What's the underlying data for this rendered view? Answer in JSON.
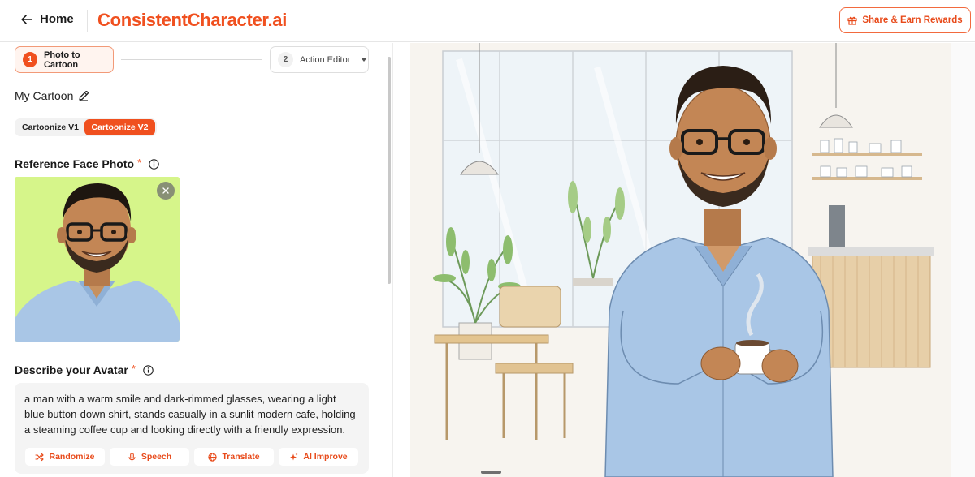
{
  "header": {
    "home_label": "Home",
    "logo": "ConsistentCharacter.ai",
    "share_label": "Share & Earn Rewards"
  },
  "steps": [
    {
      "num": "1",
      "label": "Photo to Cartoon",
      "active": true
    },
    {
      "num": "2",
      "label": "Action Editor",
      "active": false
    }
  ],
  "cartoon": {
    "name": "My Cartoon"
  },
  "version_tabs": {
    "v1": "Cartoonize V1",
    "v2": "Cartoonize V2",
    "selected": "Cartoonize V2"
  },
  "reference": {
    "label": "Reference Face Photo",
    "required": "*"
  },
  "describe": {
    "label": "Describe your Avatar",
    "required": "*",
    "text": "a man with a warm smile and dark-rimmed glasses, wearing a light blue button-down shirt, stands casually in a sunlit modern cafe, holding a steaming coffee cup and looking directly with a friendly expression."
  },
  "tools": {
    "randomize": "Randomize",
    "speech": "Speech",
    "translate": "Translate",
    "improve": "AI Improve"
  },
  "colors": {
    "accent": "#f0501f",
    "photo_bg": "#d6f58a",
    "shirt": "#a9c6e6"
  },
  "icons": [
    "arrow-left-icon",
    "gift-icon",
    "pencil-icon",
    "info-icon",
    "close-icon",
    "shuffle-icon",
    "microphone-icon",
    "globe-icon",
    "sparkle-icon",
    "chevron-down-icon"
  ]
}
